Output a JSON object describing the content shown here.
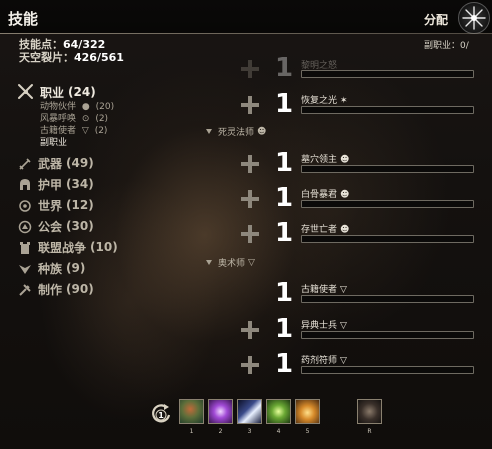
{
  "header": {
    "title": "技能",
    "assign_label": "分配"
  },
  "stats": {
    "skill_points_label": "技能点：",
    "skill_points_value": "64/322",
    "sky_shards_label": "天空裂片：",
    "sky_shards_value": "426/561",
    "subclass_label": "副职业：0/"
  },
  "nav": {
    "class": {
      "label": "职业",
      "count": "(24)"
    },
    "class_subs": [
      {
        "label": "动物伙伴",
        "count": "(20)"
      },
      {
        "label": "风暴呼唤",
        "count": "(2)"
      },
      {
        "label": "古籍使者",
        "count": "(2)"
      },
      {
        "label": "副职业",
        "count": ""
      }
    ],
    "items": [
      {
        "label": "武器",
        "count": "(49)"
      },
      {
        "label": "护甲",
        "count": "(34)"
      },
      {
        "label": "世界",
        "count": "(12)"
      },
      {
        "label": "公会",
        "count": "(30)"
      },
      {
        "label": "联盟战争",
        "count": "(10)"
      },
      {
        "label": "种族",
        "count": "(9)"
      },
      {
        "label": "制作",
        "count": "(90)"
      }
    ]
  },
  "skills": {
    "top_faded": {
      "rank": "1",
      "name": "黎明之怒"
    },
    "restoring_light": {
      "rank": "1",
      "name": "恢复之光",
      "progress": 0
    },
    "necromancer_header": "死灵法师",
    "necromancer": [
      {
        "rank": "1",
        "name": "墓穴领主",
        "progress": 0
      },
      {
        "rank": "1",
        "name": "白骨暴君",
        "progress": 0
      },
      {
        "rank": "1",
        "name": "存世亡者",
        "progress": 0
      }
    ],
    "arcanist_header": "奥术师",
    "arcanist": [
      {
        "rank": "1",
        "name": "古籍使者",
        "progress": 0,
        "has_plus": false
      },
      {
        "rank": "1",
        "name": "异典士兵",
        "progress": 0,
        "has_plus": true
      },
      {
        "rank": "1",
        "name": "药剂符师",
        "progress": 0,
        "has_plus": true
      }
    ]
  },
  "action_bar": {
    "swap_badge": "1",
    "slots": [
      {
        "num": "1",
        "icon": "animal-companion-skill-icon"
      },
      {
        "num": "2",
        "icon": "lightning-skill-icon"
      },
      {
        "num": "3",
        "icon": "light-beam-skill-icon"
      },
      {
        "num": "4",
        "icon": "green-rune-skill-icon"
      },
      {
        "num": "5",
        "icon": "winged-skill-icon"
      }
    ],
    "ultimate": {
      "num": "R",
      "icon": "fist-ultimate-icon"
    }
  }
}
